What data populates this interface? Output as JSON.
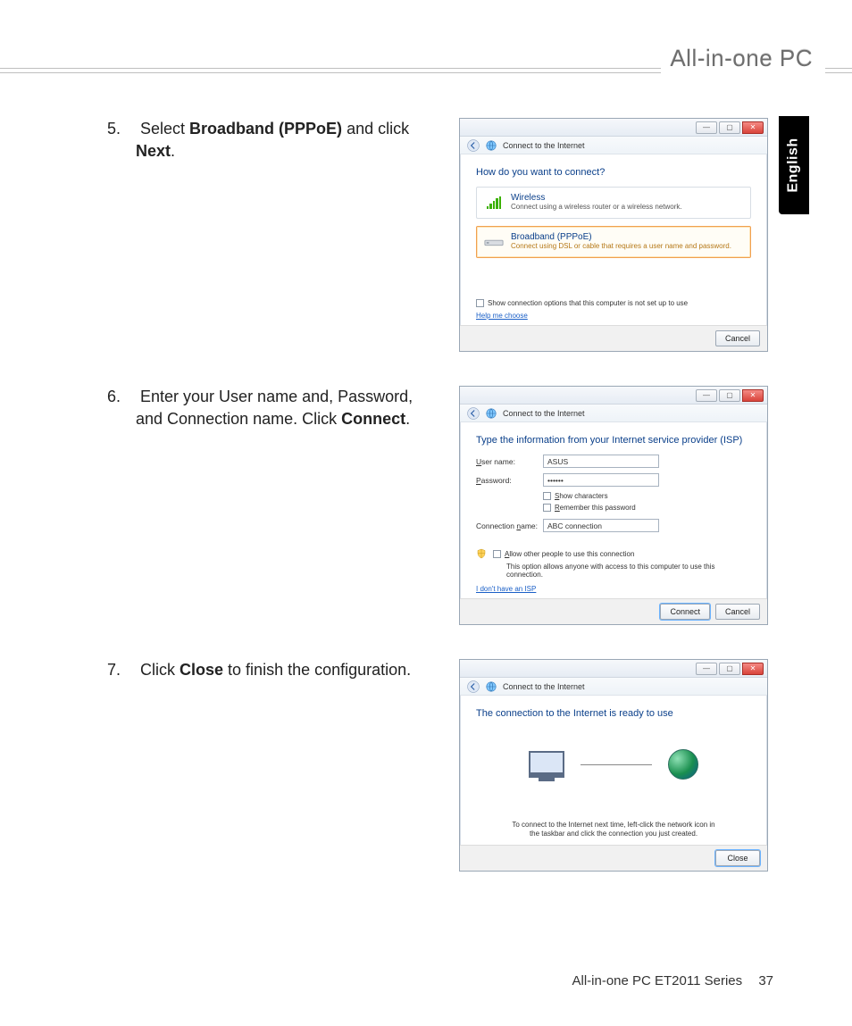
{
  "brand": "All-in-one PC",
  "language_tab": "English",
  "footer_model": "All-in-one PC ET2011 Series",
  "page_number": "37",
  "steps": {
    "s5": {
      "n": "5.",
      "p1": "Select ",
      "b1": "Broadband (PPPoE)",
      "p2": " and click ",
      "b2": "Next",
      "p3": "."
    },
    "s6": {
      "n": "6.",
      "p1": "Enter your User name and, Password, and Connection name. Click ",
      "b1": "Connect",
      "p2": "."
    },
    "s7": {
      "n": "7.",
      "p1": "Click ",
      "b1": "Close",
      "p2": " to finish the configuration."
    }
  },
  "dlg_shared": {
    "title": "Connect to the Internet",
    "cancel": "Cancel",
    "close": "Close",
    "connect": "Connect"
  },
  "dlg5": {
    "heading": "How do you want to connect?",
    "wireless_title": "Wireless",
    "wireless_sub": "Connect using a wireless router or a wireless network.",
    "bb_title": "Broadband (PPPoE)",
    "bb_sub": "Connect using DSL or cable that requires a user name and password.",
    "chk": "Show connection options that this computer is not set up to use",
    "help": "Help me choose"
  },
  "dlg6": {
    "heading": "Type the information from your Internet service provider (ISP)",
    "user_lbl_u": "U",
    "user_lbl_rest": "ser name:",
    "user_val": "ASUS",
    "pass_lbl_u": "P",
    "pass_lbl_rest": "assword:",
    "pass_val": "••••••",
    "showchars_u": "S",
    "showchars_rest": "how characters",
    "remember_u": "R",
    "remember_rest": "emember this password",
    "conn_lbl": "Connection ",
    "conn_lbl_u": "n",
    "conn_lbl_rest": "ame:",
    "conn_val": "ABC connection",
    "allow_u": "A",
    "allow_rest": "llow other people to use this connection",
    "allow_note": "This option allows anyone with access to this computer to use this connection.",
    "noisp": "I don't have an ISP"
  },
  "dlg7": {
    "heading": "The connection to the Internet is ready to use",
    "tip": "To connect to the Internet next time, left-click the network icon in the taskbar and click the connection you just created."
  }
}
